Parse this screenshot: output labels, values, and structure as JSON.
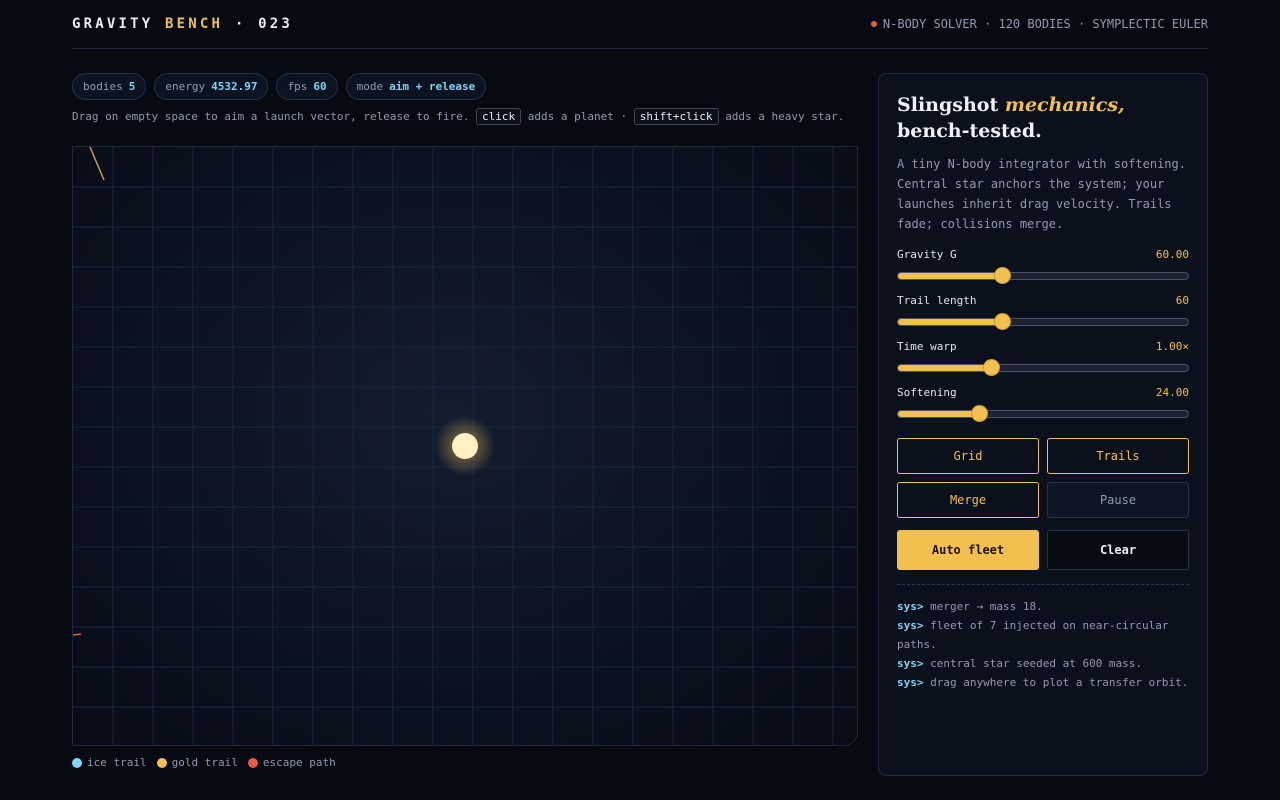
{
  "header": {
    "brand_prefix": "GRAVITY",
    "brand_accent": "BENCH",
    "brand_suffix": "· 023",
    "solver_info": "N-BODY SOLVER · 120 BODIES · SYMPLECTIC EULER",
    "status_color": "#e85a4a"
  },
  "stats": [
    {
      "label": "bodies",
      "value": "5"
    },
    {
      "label": "energy",
      "value": "4532.97"
    },
    {
      "label": "fps",
      "value": "60"
    },
    {
      "label": "mode",
      "value": "aim + release"
    }
  ],
  "hint": {
    "part1": "Drag on empty space to aim a launch vector, release to fire.",
    "key1": "click",
    "part2": "adds a planet ·",
    "key2": "shift+click",
    "part3": "adds a heavy star."
  },
  "legend": [
    {
      "label": "ice trail",
      "color": "#7fd3f5"
    },
    {
      "label": "gold trail",
      "color": "#f2c04f"
    },
    {
      "label": "escape path",
      "color": "#e85a4a"
    }
  ],
  "panel": {
    "title_start": "Slingshot",
    "title_em": "mechanics,",
    "title_end": "bench-tested.",
    "description": "A tiny N-body integrator with softening. Central star anchors the system; your launches inherit drag velocity. Trails fade; collisions merge.",
    "sliders": [
      {
        "label": "Gravity G",
        "value": "60.00",
        "fraction": 0.36
      },
      {
        "label": "Trail length",
        "value": "60",
        "fraction": 0.36
      },
      {
        "label": "Time warp",
        "value": "1.00×",
        "fraction": 0.32
      },
      {
        "label": "Softening",
        "value": "24.00",
        "fraction": 0.28
      }
    ],
    "toggles": [
      {
        "label": "Grid",
        "active": true
      },
      {
        "label": "Trails",
        "active": true
      },
      {
        "label": "Merge",
        "active": true
      },
      {
        "label": "Pause",
        "active": false
      }
    ],
    "actions": {
      "primary": "Auto fleet",
      "secondary": "Clear"
    },
    "log_prompt": "sys>",
    "log": [
      "merger → mass 18.",
      "fleet of 7 injected on near-circular paths.",
      "central star seeded at 600 mass.",
      "drag anywhere to plot a transfer orbit."
    ]
  },
  "colors": {
    "accent": "#f2c04f",
    "ice": "#7fd3f5",
    "danger": "#e85a4a"
  }
}
